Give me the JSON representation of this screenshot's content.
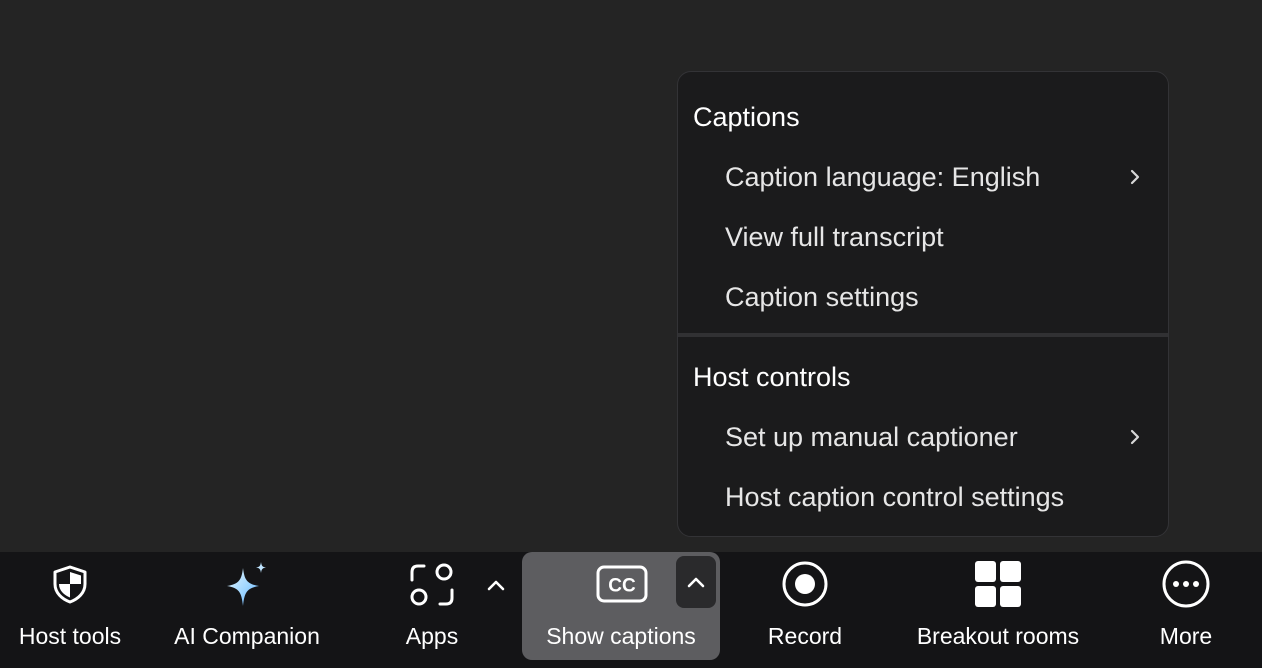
{
  "menu": {
    "section_captions": {
      "header": "Captions",
      "items": [
        {
          "label": "Caption language: English",
          "has_submenu": true
        },
        {
          "label": "View full transcript",
          "has_submenu": false
        },
        {
          "label": "Caption settings",
          "has_submenu": false
        }
      ]
    },
    "section_host": {
      "header": "Host controls",
      "items": [
        {
          "label": "Set up manual captioner",
          "has_submenu": true
        },
        {
          "label": "Host caption control settings",
          "has_submenu": false
        }
      ]
    }
  },
  "toolbar": {
    "host_tools": {
      "label": "Host tools",
      "icon": "shield-icon"
    },
    "ai_companion": {
      "label": "AI Companion",
      "icon": "sparkle-icon"
    },
    "apps": {
      "label": "Apps",
      "icon": "apps-icon"
    },
    "show_captions": {
      "label": "Show captions",
      "icon": "cc-icon",
      "icon_text": "CC",
      "active": true
    },
    "record": {
      "label": "Record",
      "icon": "record-icon"
    },
    "breakout_rooms": {
      "label": "Breakout rooms",
      "icon": "grid-icon"
    },
    "more": {
      "label": "More",
      "icon": "more-icon"
    }
  },
  "colors": {
    "background": "#242424",
    "menu_bg": "#1b1b1c",
    "toolbar_bg": "#141416",
    "active_tool_bg": "#5d5d60",
    "text": "#ffffff"
  }
}
